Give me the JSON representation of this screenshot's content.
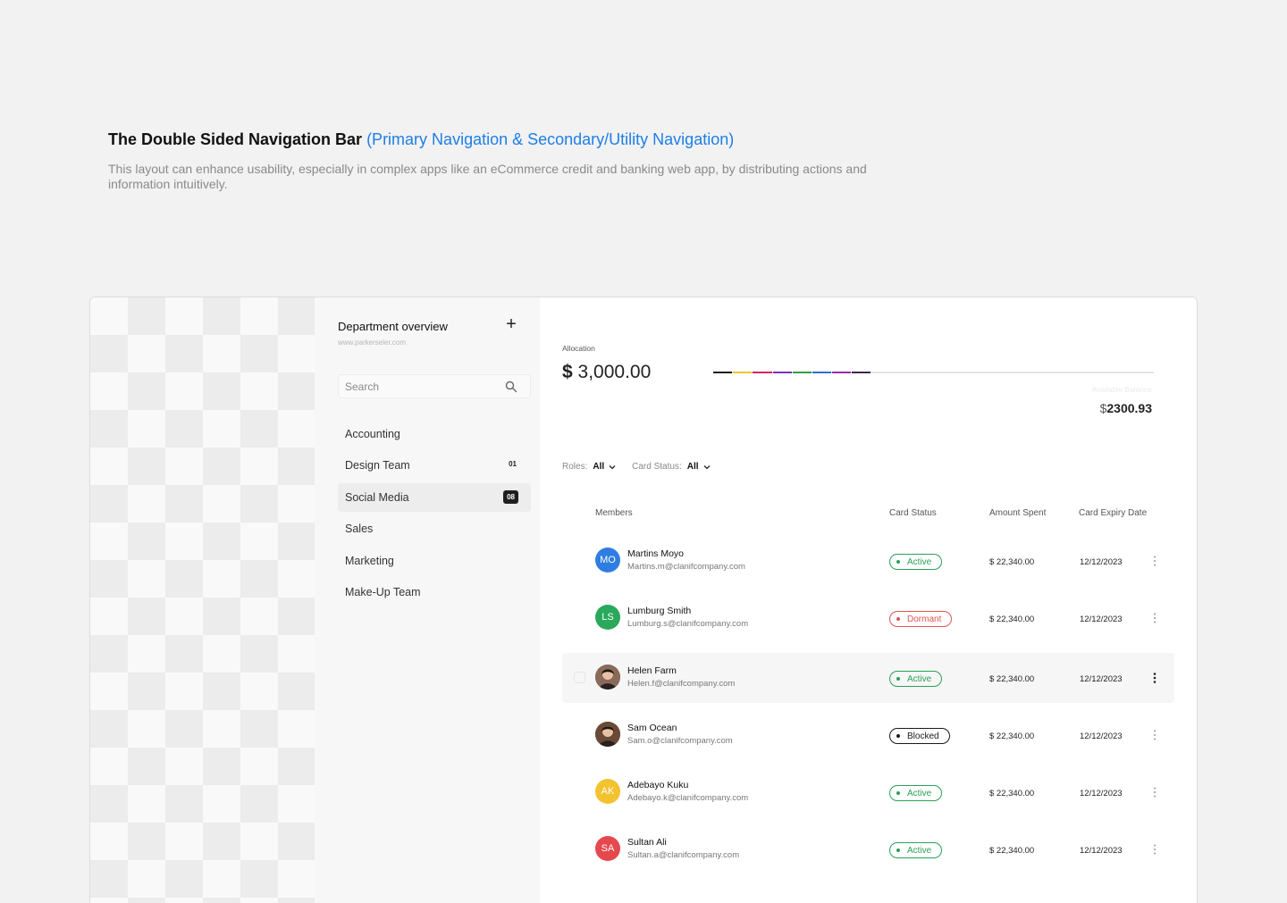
{
  "heading": {
    "title": "The Double Sided Navigation Bar",
    "accent": "(Primary Navigation & Secondary/Utility Navigation)",
    "description": "This layout can enhance usability, especially in complex apps like an eCommerce credit and banking web app, by distributing actions and information intuitively."
  },
  "sidebar": {
    "title": "Department overview",
    "url": "www.parkerseler.com",
    "add_icon": "plus-icon",
    "search_placeholder": "Search",
    "search_icon": "search-icon",
    "items": [
      {
        "label": "Accounting",
        "count": ""
      },
      {
        "label": "Design Team",
        "count": "01"
      },
      {
        "label": "Social Media",
        "count": "08",
        "active": true
      },
      {
        "label": "Sales",
        "count": ""
      },
      {
        "label": "Marketing",
        "count": ""
      },
      {
        "label": "Make-Up Team",
        "count": ""
      }
    ]
  },
  "allocation": {
    "label": "Allocation",
    "currency": "$",
    "amount": "3,000.00",
    "used_fraction": 0.36,
    "available_label": "Available Balance",
    "available_currency": "$",
    "available_amount": "2300.93",
    "bar_colors": [
      "#1b1b1b",
      "#e8c930",
      "#d6255a",
      "#7b2fbe",
      "#2e9f4b",
      "#2c6fd8",
      "#9b2aa5",
      "#3a2a4a"
    ]
  },
  "filters": {
    "roles_label": "Roles:",
    "roles_value": "All",
    "status_label": "Card Status:",
    "status_value": "All"
  },
  "table": {
    "headers": {
      "members": "Members",
      "status": "Card Status",
      "amount": "Amount Spent",
      "expiry": "Card Expiry Date"
    },
    "rows": [
      {
        "initials": "MO",
        "avatar_color": "#2f7de1",
        "name": "Martins Moyo",
        "email": "Martins.m@clanifcompany.com",
        "status": "Active",
        "amount": "$ 22,340.00",
        "expiry": "12/12/2023"
      },
      {
        "initials": "LS",
        "avatar_color": "#2aa85c",
        "name": "Lumburg Smith",
        "email": "Lumburg.s@clanifcompany.com",
        "status": "Dormant",
        "amount": "$ 22,340.00",
        "expiry": "12/12/2023"
      },
      {
        "initials": "",
        "avatar_color": "#8a6a5a",
        "name": "Helen Farm",
        "email": "Helen.f@clanifcompany.com",
        "status": "Active",
        "amount": "$ 22,340.00",
        "expiry": "12/12/2023",
        "highlighted": true
      },
      {
        "initials": "",
        "avatar_color": "#6b4a35",
        "name": "Sam Ocean",
        "email": "Sam.o@clanifcompany.com",
        "status": "Blocked",
        "amount": "$ 22,340.00",
        "expiry": "12/12/2023"
      },
      {
        "initials": "AK",
        "avatar_color": "#f2c230",
        "name": "Adebayo Kuku",
        "email": "Adebayo.k@clanifcompany.com",
        "status": "Active",
        "amount": "$ 22,340.00",
        "expiry": "12/12/2023"
      },
      {
        "initials": "SA",
        "avatar_color": "#e5484d",
        "name": "Sultan Ali",
        "email": "Sultan.a@clanifcompany.com",
        "status": "Active",
        "amount": "$ 22,340.00",
        "expiry": "12/12/2023"
      }
    ]
  },
  "status_colors": {
    "Active": "#2aa05a",
    "Dormant": "#e05252",
    "Blocked": "#1a1a1a"
  }
}
